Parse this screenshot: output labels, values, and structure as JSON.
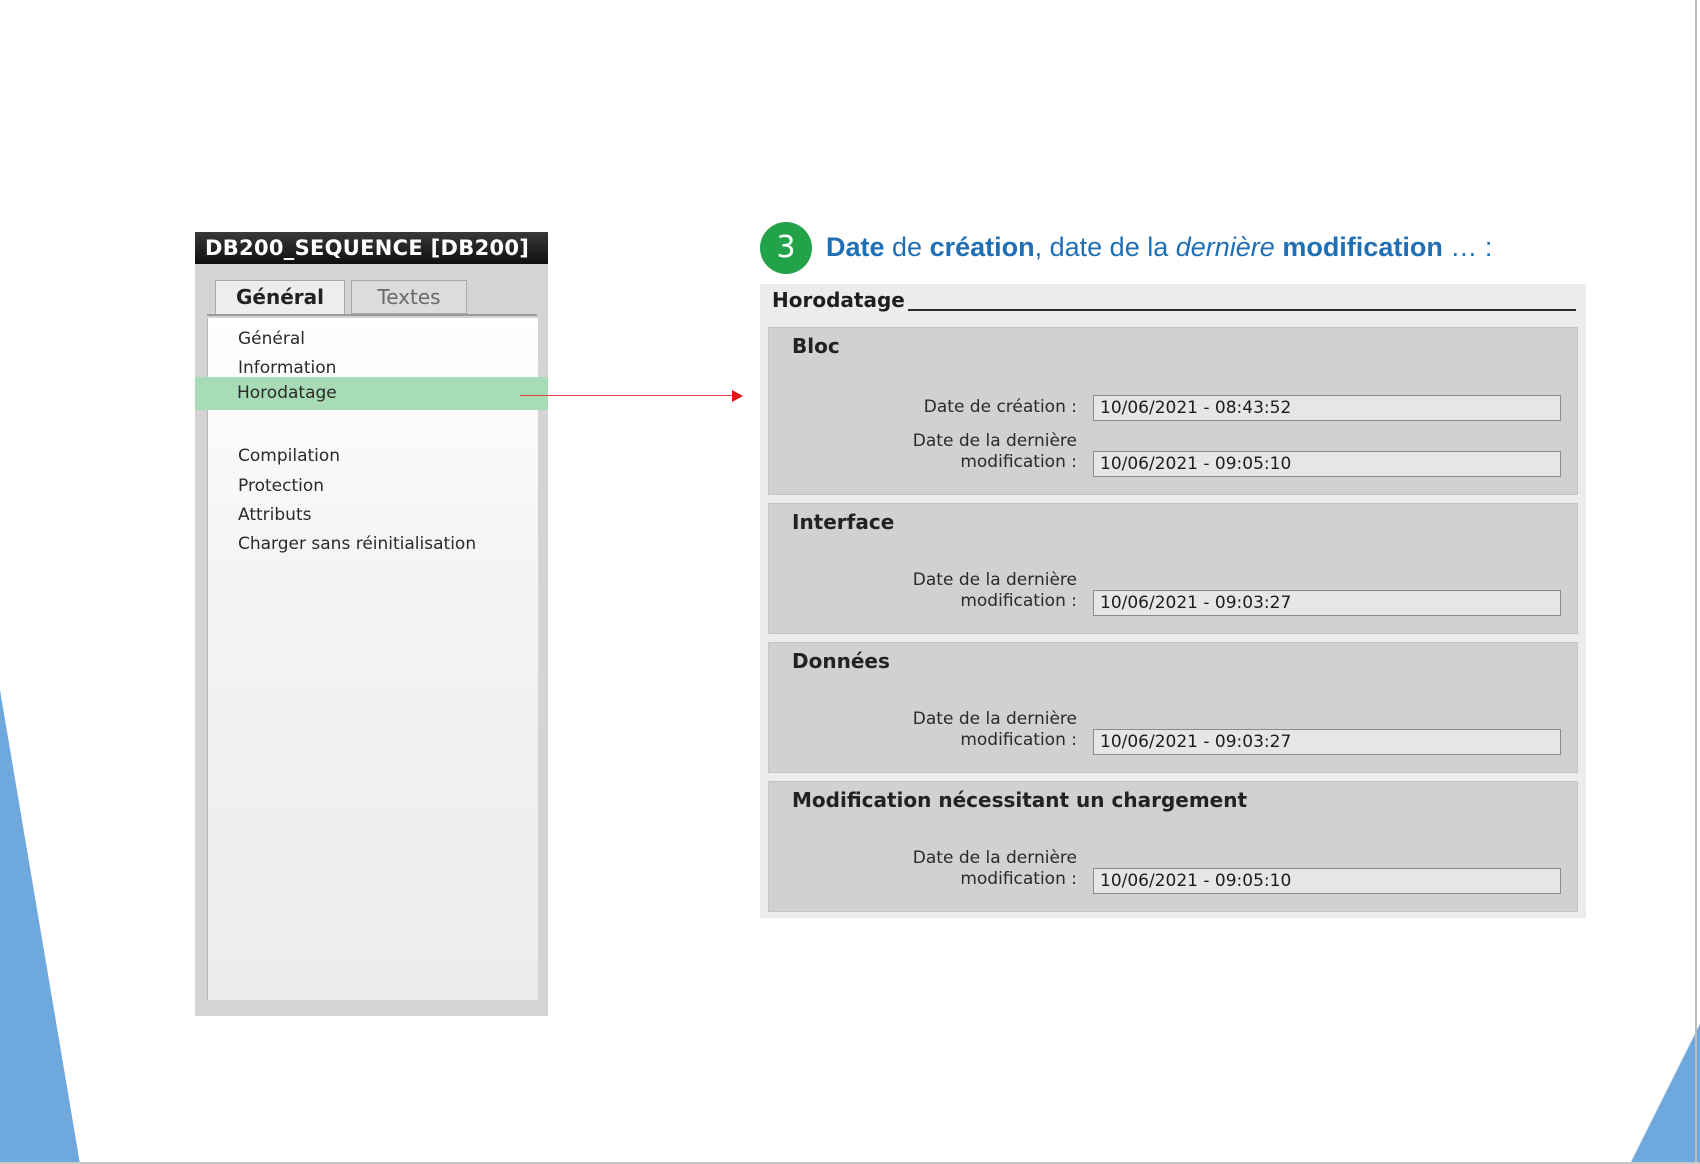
{
  "left_panel": {
    "title": "DB200_SEQUENCE [DB200]",
    "tabs": [
      {
        "label": "Général",
        "active": true
      },
      {
        "label": "Textes",
        "active": false
      }
    ],
    "items": [
      {
        "label": "Général"
      },
      {
        "label": "Information"
      },
      {
        "label": "Horodatage",
        "selected": true
      },
      {
        "label": "Compilation"
      },
      {
        "label": "Protection"
      },
      {
        "label": "Attributs"
      },
      {
        "label": "Charger sans réinitialisation"
      }
    ]
  },
  "callout": {
    "number": "3",
    "heading": {
      "part1": "Date",
      "part2": " de ",
      "part3": "création",
      "part4": ", date de la ",
      "part5": "dernière",
      "part6": " ",
      "part7": "modification",
      "part8": " … :"
    }
  },
  "right_panel": {
    "title": "Horodatage",
    "sections": [
      {
        "title": "Bloc",
        "fields": [
          {
            "label": "Date de création :",
            "value": "10/06/2021 - 08:43:52"
          },
          {
            "label_line1": "Date de la dernière",
            "label_line2": "modification :",
            "value": "10/06/2021 - 09:05:10"
          }
        ]
      },
      {
        "title": "Interface",
        "fields": [
          {
            "label_line1": "Date de la dernière",
            "label_line2": "modification :",
            "value": "10/06/2021 - 09:03:27"
          }
        ]
      },
      {
        "title": "Données",
        "fields": [
          {
            "label_line1": "Date de la dernière",
            "label_line2": "modification :",
            "value": "10/06/2021 - 09:03:27"
          }
        ]
      },
      {
        "title": "Modification nécessitant un chargement",
        "fields": [
          {
            "label_line1": "Date de la dernière",
            "label_line2": "modification :",
            "value": "10/06/2021 - 09:05:10"
          }
        ]
      }
    ]
  },
  "colors": {
    "accent_blue": "#1f6fb5",
    "badge_green": "#22a34a",
    "selection_green": "#a7dcb6",
    "arrow_red": "#e01818",
    "deco_blue": "#6fa8dc"
  }
}
